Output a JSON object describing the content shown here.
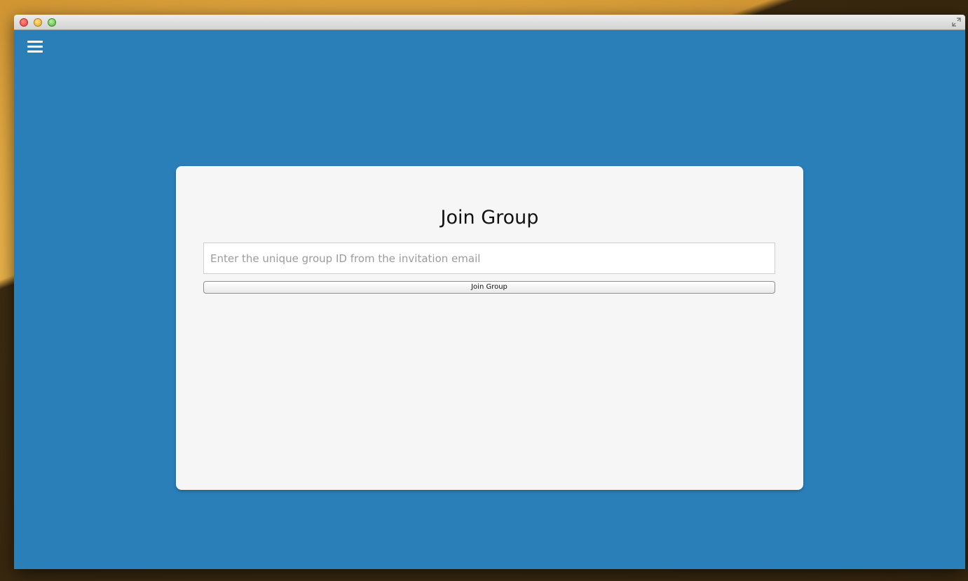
{
  "window": {
    "accent_color": "#2a7fb8",
    "card_color": "#f6f6f6"
  },
  "icons": {
    "menu": "hamburger-menu-icon",
    "fullscreen": "fullscreen-arrows-icon"
  },
  "join_group": {
    "title": "Join Group",
    "input_placeholder": "Enter the unique group ID from the invitation email",
    "input_value": "",
    "button_label": "Join Group"
  }
}
